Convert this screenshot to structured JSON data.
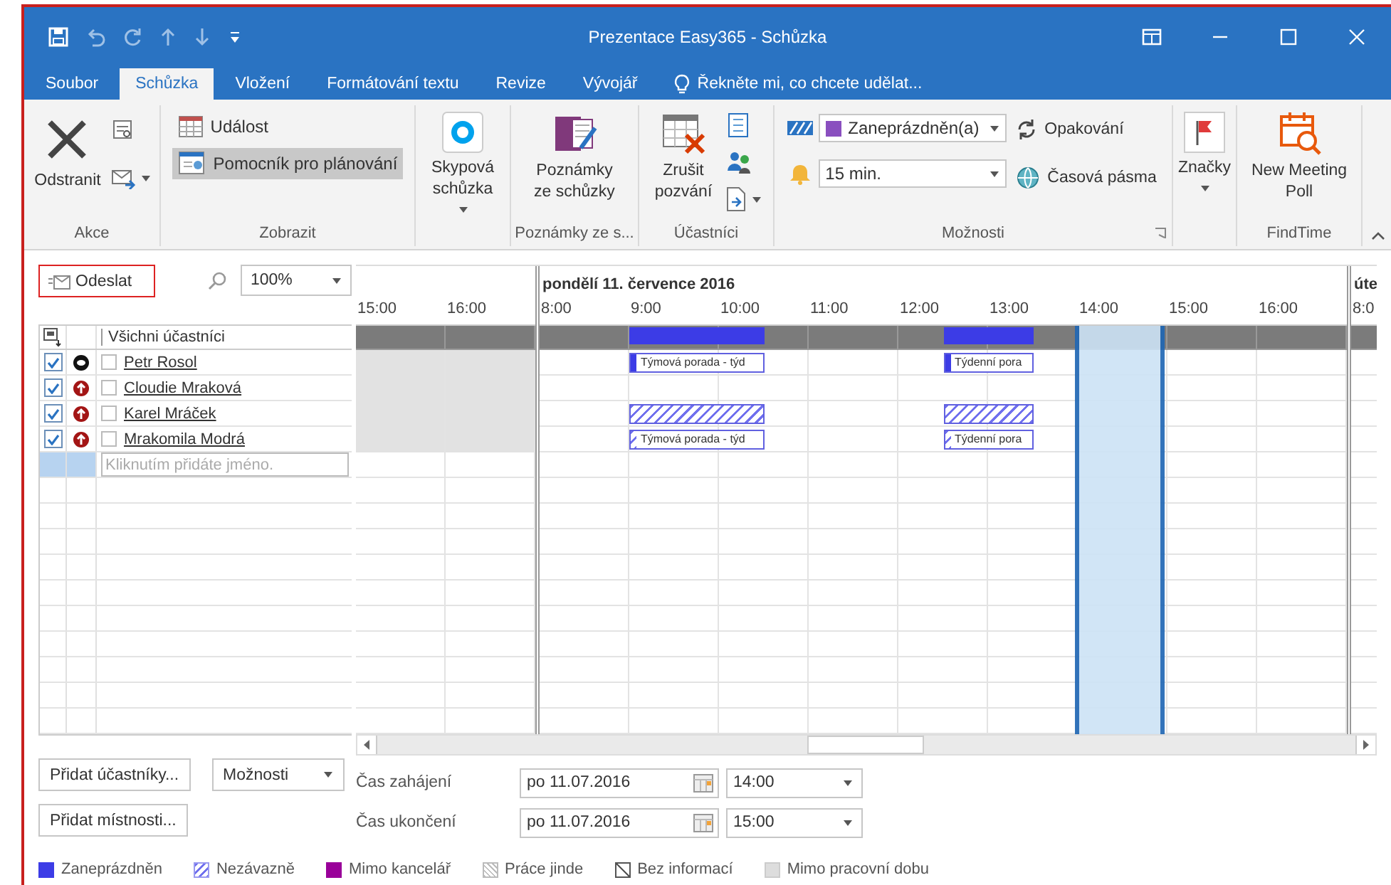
{
  "window": {
    "title": "Prezentace Easy365 - Schůzka"
  },
  "tabs": [
    {
      "label": "Soubor",
      "selected": false
    },
    {
      "label": "Schůzka",
      "selected": true
    },
    {
      "label": "Vložení",
      "selected": false
    },
    {
      "label": "Formátování textu",
      "selected": false
    },
    {
      "label": "Revize",
      "selected": false
    },
    {
      "label": "Vývojář",
      "selected": false
    }
  ],
  "tell_me": {
    "text": "Řekněte mi, co chcete udělat..."
  },
  "ribbon": {
    "groups": [
      {
        "label": "Akce",
        "items": [
          {
            "kind": "large",
            "label": "Odstranit"
          },
          {
            "kind": "stack",
            "items": [
              {
                "kind": "icon"
              },
              {
                "kind": "icon",
                "dropdown": true
              }
            ]
          }
        ]
      },
      {
        "label": "Zobrazit",
        "items": [
          {
            "kind": "stack",
            "items": [
              {
                "kind": "small",
                "label": "Událost",
                "selected": false
              },
              {
                "kind": "small",
                "label": "Pomocník pro plánování",
                "selected": true
              }
            ]
          }
        ]
      },
      {
        "items": [
          {
            "kind": "large",
            "label": "Skypová schůzka",
            "dropdown": true
          }
        ]
      },
      {
        "label": "Poznámky ze s...",
        "items": [
          {
            "kind": "large",
            "label": "Poznámky ze schůzky"
          }
        ]
      },
      {
        "label": "Účastníci",
        "items": [
          {
            "kind": "large",
            "label": "Zrušit pozvání"
          },
          {
            "kind": "stack",
            "items": [
              {
                "kind": "icon"
              },
              {
                "kind": "icon"
              },
              {
                "kind": "icon",
                "dropdown": true
              }
            ]
          }
        ]
      },
      {
        "label": "Možnosti",
        "launcher": true,
        "items": [
          {
            "kind": "stack",
            "items": [
              {
                "kind": "select",
                "value": "Zaneprázdněn(a)"
              },
              {
                "kind": "select",
                "value": "15 min."
              }
            ]
          },
          {
            "kind": "stack",
            "items": [
              {
                "kind": "small",
                "label": "Opakování"
              },
              {
                "kind": "small",
                "label": "Časová pásma"
              }
            ]
          }
        ]
      },
      {
        "items": [
          {
            "kind": "large",
            "label": "Značky",
            "dropdown": true
          }
        ]
      },
      {
        "label": "FindTime",
        "items": [
          {
            "kind": "large",
            "label": "New Meeting Poll"
          }
        ]
      }
    ]
  },
  "send_button": {
    "label": "Odeslat"
  },
  "zoom": {
    "value": "100%"
  },
  "attendees_header": "Všichni účastníci",
  "attendees": [
    {
      "name": "Petr Rosol",
      "checked": true,
      "kind": "organizer",
      "marked": false,
      "slots": [
        {
          "kind": "free"
        },
        {
          "kind": "free"
        },
        {
          "kind": "busy"
        },
        {
          "kind": "busy"
        },
        {
          "kind": "busy"
        },
        {
          "kind": "free"
        },
        {
          "kind": "free"
        },
        {
          "kind": "free"
        },
        {
          "kind": "free"
        },
        {
          "kind": "busy"
        },
        {
          "kind": "busy"
        },
        {
          "kind": "free"
        },
        {
          "kind": "free"
        },
        {
          "kind": "free"
        },
        {
          "kind": "free"
        },
        {
          "kind": "free"
        },
        {
          "kind": "free"
        },
        {
          "kind": "free"
        }
      ],
      "labels": [
        "Týmová porada - týd",
        "Týdenní pora"
      ]
    },
    {
      "name": "Cloudie Mraková",
      "checked": true,
      "kind": "required",
      "marked": false,
      "slots": [
        {
          "kind": "free"
        },
        {
          "kind": "free"
        },
        {
          "kind": "free"
        },
        {
          "kind": "free"
        },
        {
          "kind": "free"
        },
        {
          "kind": "free"
        },
        {
          "kind": "free"
        },
        {
          "kind": "free"
        },
        {
          "kind": "free"
        },
        {
          "kind": "free"
        },
        {
          "kind": "free"
        },
        {
          "kind": "free"
        },
        {
          "kind": "free"
        },
        {
          "kind": "free"
        },
        {
          "kind": "free"
        },
        {
          "kind": "free"
        },
        {
          "kind": "free"
        },
        {
          "kind": "free"
        }
      ]
    },
    {
      "name": "Karel Mráček",
      "checked": true,
      "kind": "required",
      "marked": false,
      "slots": [
        {
          "kind": "free"
        },
        {
          "kind": "free"
        },
        {
          "kind": "tentative"
        },
        {
          "kind": "tentative"
        },
        {
          "kind": "tentative"
        },
        {
          "kind": "free"
        },
        {
          "kind": "free"
        },
        {
          "kind": "free"
        },
        {
          "kind": "free"
        },
        {
          "kind": "tentative"
        },
        {
          "kind": "tentative"
        },
        {
          "kind": "free"
        },
        {
          "kind": "free"
        },
        {
          "kind": "free"
        },
        {
          "kind": "free"
        },
        {
          "kind": "free"
        },
        {
          "kind": "free"
        },
        {
          "kind": "free"
        }
      ]
    },
    {
      "name": "Mrakomila Modrá",
      "checked": true,
      "kind": "required",
      "marked": false,
      "slots": [
        {
          "kind": "free"
        },
        {
          "kind": "free"
        },
        {
          "kind": "tentative"
        },
        {
          "kind": "tentative"
        },
        {
          "kind": "tentative"
        },
        {
          "kind": "free"
        },
        {
          "kind": "free"
        },
        {
          "kind": "free"
        },
        {
          "kind": "free"
        },
        {
          "kind": "tentative"
        },
        {
          "kind": "tentative"
        },
        {
          "kind": "free"
        },
        {
          "kind": "free"
        },
        {
          "kind": "free"
        },
        {
          "kind": "free"
        },
        {
          "kind": "free"
        },
        {
          "kind": "free"
        },
        {
          "kind": "free"
        }
      ],
      "labels": [
        "Týmová porada - týd",
        "Týdenní pora"
      ]
    }
  ],
  "add_attendee": {
    "placeholder": "Kliknutím přidáte jméno."
  },
  "timeline": {
    "days": [
      {
        "hours": [
          {
            "label": "15:00",
            "shaded": true
          },
          {
            "label": "16:00",
            "shaded": true
          }
        ]
      },
      {
        "heading": "pondělí 11. července 2016",
        "hours": [
          {
            "label": "8:00"
          },
          {
            "label": "9:00"
          },
          {
            "label": "10:00"
          },
          {
            "label": "11:00"
          },
          {
            "label": "12:00"
          },
          {
            "label": "13:00"
          },
          {
            "label": "14:00"
          },
          {
            "label": "15:00"
          },
          {
            "label": "16:00"
          }
        ]
      },
      {
        "heading": "úte",
        "hours": [
          {
            "label": "8:0"
          }
        ]
      }
    ]
  },
  "form": {
    "add_attendees_button": "Přidat účastníky...",
    "options_dropdown": "Možnosti",
    "add_rooms_button": "Přidat místnosti...",
    "start": {
      "label": "Čas zahájení",
      "date": "po 11.07.2016",
      "time": "14:00"
    },
    "end": {
      "label": "Čas ukončení",
      "date": "po 11.07.2016",
      "time": "15:00"
    }
  },
  "legend": [
    {
      "kind": "busy",
      "label": "Zaneprázdněn"
    },
    {
      "kind": "tentative",
      "label": "Nezávazně"
    },
    {
      "kind": "oof",
      "label": "Mimo kancelář"
    },
    {
      "kind": "elsewhere",
      "label": "Práce jinde"
    },
    {
      "kind": "noinfo",
      "label": "Bez informací"
    },
    {
      "kind": "offhours",
      "label": "Mimo pracovní dobu"
    }
  ]
}
